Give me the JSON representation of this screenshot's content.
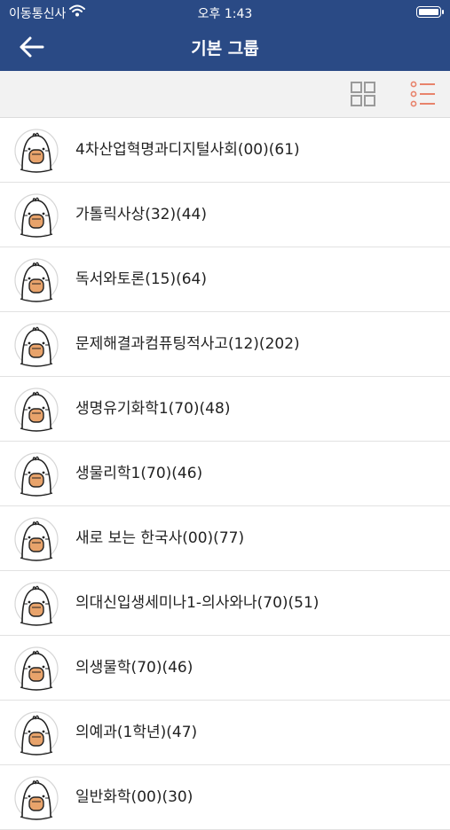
{
  "status_bar": {
    "carrier": "이동통신사",
    "time": "오후 1:43"
  },
  "nav": {
    "title": "기본 그룹",
    "back_icon": "arrow-left-icon"
  },
  "toolbar": {
    "grid_icon": "grid-view-icon",
    "list_icon": "list-view-icon",
    "active_color": "#e8836b"
  },
  "colors": {
    "header": "#2a4a85",
    "avatar_accent": "#e8a36b"
  },
  "groups": [
    {
      "label": "4차산업혁명과디지털사회(00)(61)"
    },
    {
      "label": "가톨릭사상(32)(44)"
    },
    {
      "label": "독서와토론(15)(64)"
    },
    {
      "label": "문제해결과컴퓨팅적사고(12)(202)"
    },
    {
      "label": "생명유기화학1(70)(48)"
    },
    {
      "label": "생물리학1(70)(46)"
    },
    {
      "label": "새로 보는 한국사(00)(77)"
    },
    {
      "label": "의대신입생세미나1-의사와나(70)(51)"
    },
    {
      "label": "의생물학(70)(46)"
    },
    {
      "label": "의예과(1학년)(47)"
    },
    {
      "label": "일반화학(00)(30)"
    }
  ]
}
